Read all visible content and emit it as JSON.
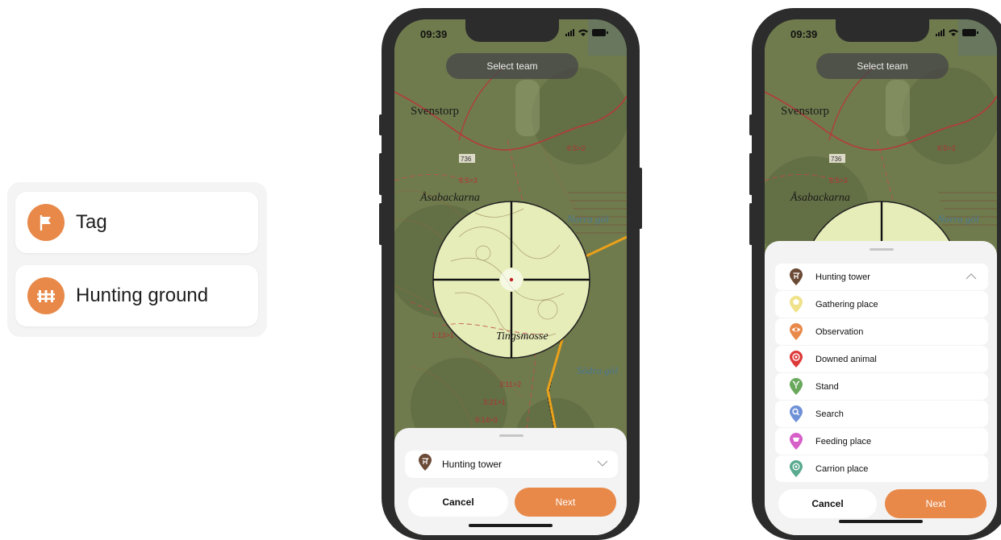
{
  "menu": {
    "items": [
      {
        "label": "Tag",
        "icon": "flag-icon"
      },
      {
        "label": "Hunting ground",
        "icon": "fence-icon"
      }
    ]
  },
  "colors": {
    "accent": "#e8894a",
    "map_green": "#6f7b4d",
    "sheet_bg": "#f3f3f3"
  },
  "status_bar": {
    "time": "09:39"
  },
  "top_bar": {
    "select_team_label": "Select team"
  },
  "map": {
    "labels": [
      "Svenstorp",
      "Åsabackarna",
      "Tingsmosse",
      "Norra göl",
      "Södra göl",
      "736",
      "6:5>3",
      "6:5>2",
      "1:13>1",
      "3:11>2",
      "3:21>1",
      "9:14>3"
    ]
  },
  "phone1": {
    "selected_type": "Hunting tower",
    "cancel_label": "Cancel",
    "next_label": "Next"
  },
  "phone2": {
    "types": [
      {
        "label": "Hunting tower",
        "icon": "hunting-tower-icon",
        "color": "#6b4a36"
      },
      {
        "label": "Gathering place",
        "icon": "gathering-place-icon",
        "color": "#efe28a"
      },
      {
        "label": "Observation",
        "icon": "observation-icon",
        "color": "#e8894a"
      },
      {
        "label": "Downed animal",
        "icon": "downed-animal-icon",
        "color": "#de3a3a"
      },
      {
        "label": "Stand",
        "icon": "stand-icon",
        "color": "#69a85d"
      },
      {
        "label": "Search",
        "icon": "search-icon",
        "color": "#6f91d8"
      },
      {
        "label": "Feeding place",
        "icon": "feeding-place-icon",
        "color": "#d75fc8"
      },
      {
        "label": "Carrion place",
        "icon": "carrion-place-icon",
        "color": "#5aaa90"
      }
    ],
    "cancel_label": "Cancel",
    "next_label": "Next"
  }
}
